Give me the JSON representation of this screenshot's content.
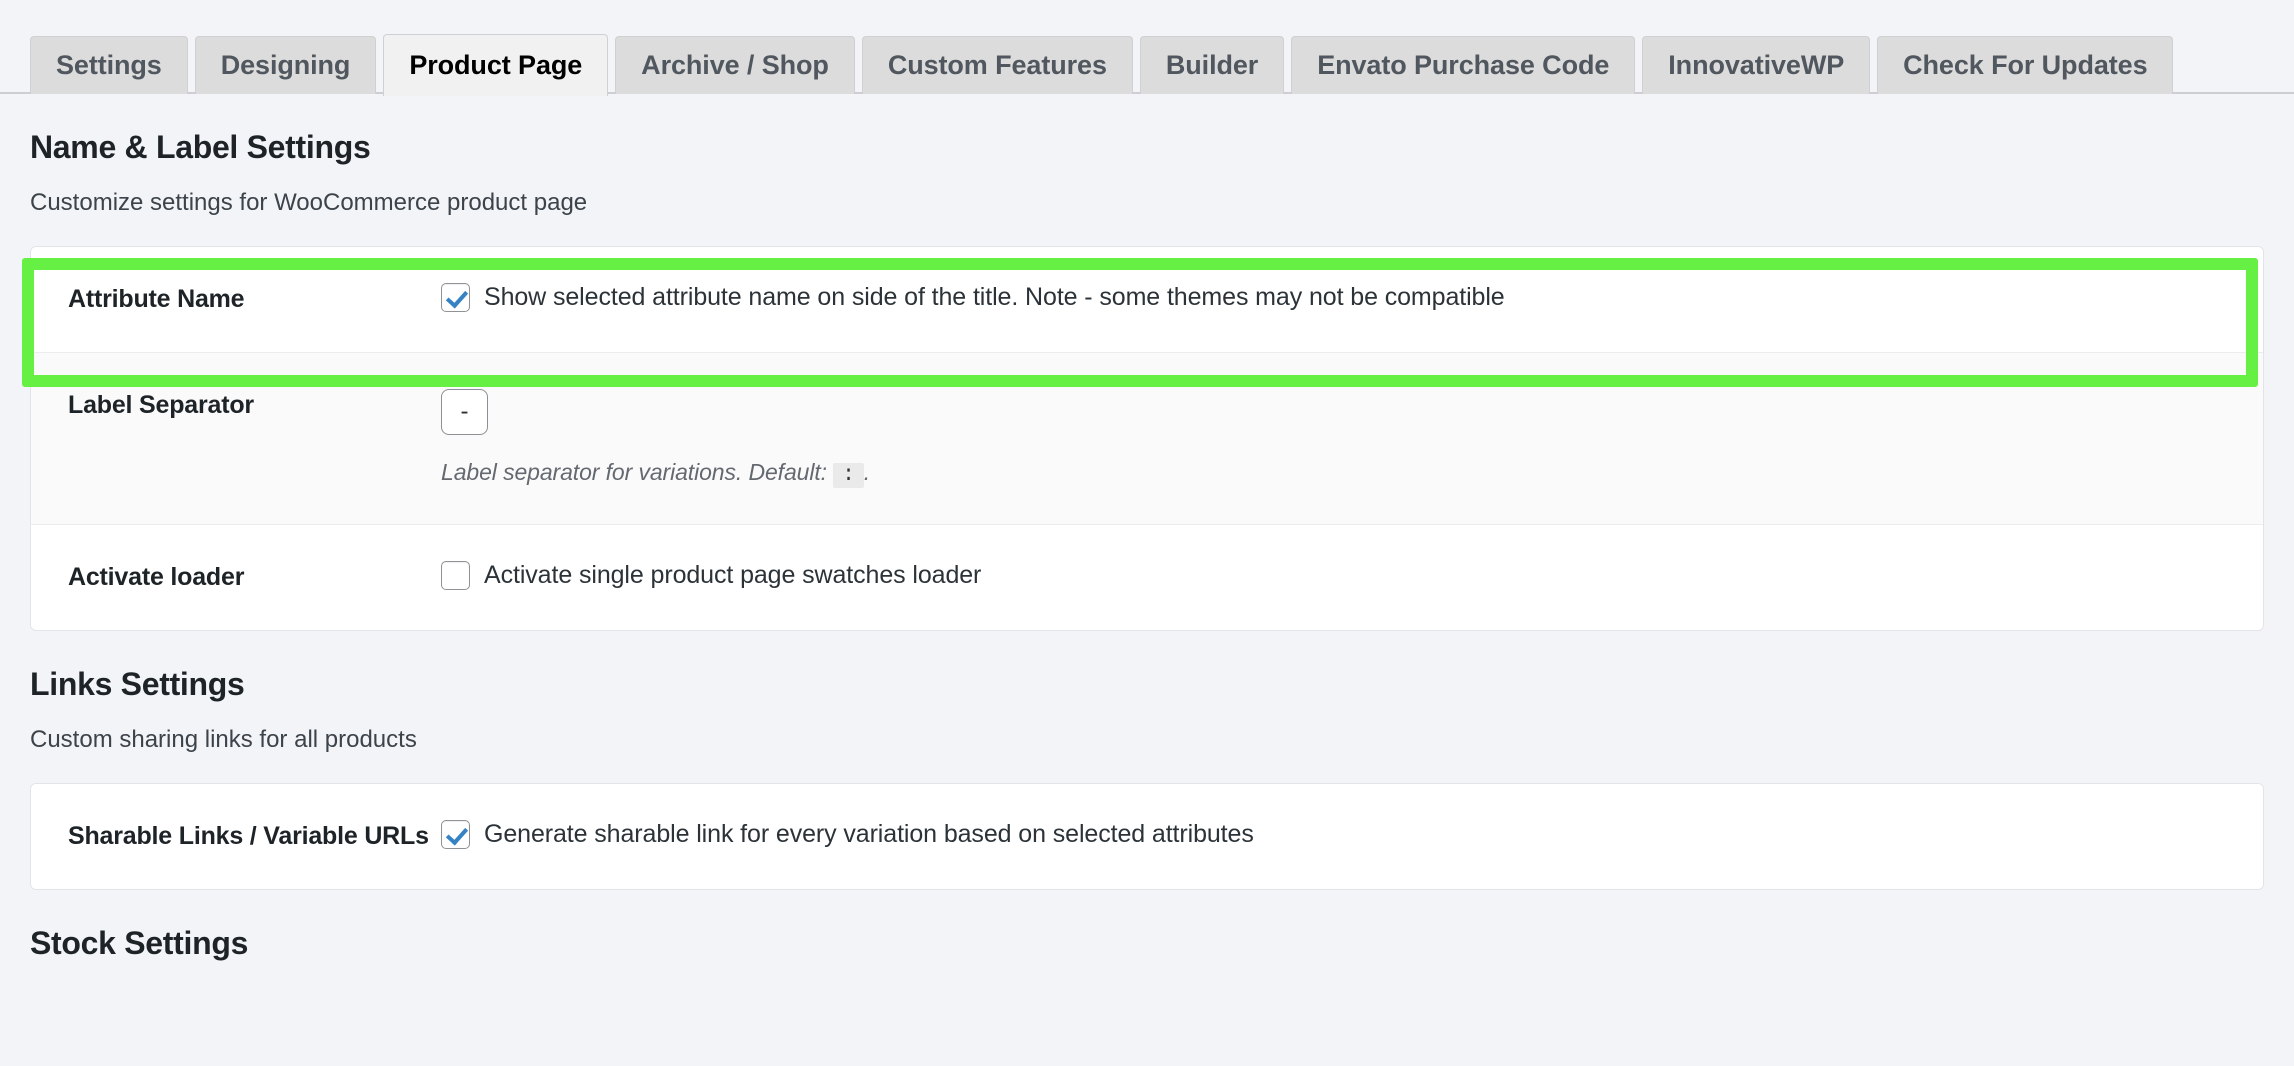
{
  "tabs": [
    {
      "label": "Settings",
      "active": false
    },
    {
      "label": "Designing",
      "active": false
    },
    {
      "label": "Product Page",
      "active": true
    },
    {
      "label": "Archive / Shop",
      "active": false
    },
    {
      "label": "Custom Features",
      "active": false
    },
    {
      "label": "Builder",
      "active": false
    },
    {
      "label": "Envato Purchase Code",
      "active": false
    },
    {
      "label": "InnovativeWP",
      "active": false
    },
    {
      "label": "Check For Updates",
      "active": false
    }
  ],
  "sections": [
    {
      "title": "Name & Label Settings",
      "description": "Customize settings for WooCommerce product page"
    },
    {
      "title": "Links Settings",
      "description": "Custom sharing links for all products"
    },
    {
      "title": "Stock Settings",
      "description": ""
    }
  ],
  "name_label_rows": {
    "attribute_name": {
      "label": "Attribute Name",
      "checkbox_label": "Show selected attribute name on side of the title. Note - some themes may not be compatible",
      "checked": true,
      "highlighted": true
    },
    "label_separator": {
      "label": "Label Separator",
      "value": "-",
      "description_prefix": "Label separator for variations. Default:",
      "description_code": ":",
      "description_suffix": "."
    },
    "activate_loader": {
      "label": "Activate loader",
      "checkbox_label": "Activate single product page swatches loader",
      "checked": false
    }
  },
  "links_rows": {
    "sharable_links": {
      "label": "Sharable Links / Variable URLs",
      "checkbox_label": "Generate sharable link for every variation based on selected attributes",
      "checked": true
    }
  },
  "colors": {
    "highlight": "#66f044",
    "checkbox_check": "#3582c4",
    "page_bg": "#f3f4f7",
    "tab_active_bg": "#f1f1f1",
    "tab_inactive_bg": "#dcdcdc"
  }
}
